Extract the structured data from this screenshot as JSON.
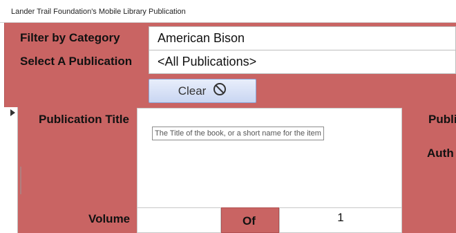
{
  "window": {
    "title": "Lander Trail Foundation's Mobile Library Publication"
  },
  "filters": {
    "category_label": "Filter by Category",
    "category_value": "American Bison",
    "publication_label": "Select A Publication",
    "publication_value": "<All Publications>",
    "clear_label": "Clear"
  },
  "record": {
    "title_label": "Publication Title",
    "title_tooltip": "The Title of the book, or a short name for the item",
    "right_label_1": "Publi",
    "right_label_2": "Auth",
    "volume_label": "Volume",
    "of_label": "Of",
    "of_value": "1"
  },
  "colors": {
    "form_background": "#c96463",
    "button_fill": "#d6e0f6"
  },
  "icons": {
    "clear_icon": "prohibited-circle-icon",
    "record_selector": "triangle-right-icon"
  }
}
